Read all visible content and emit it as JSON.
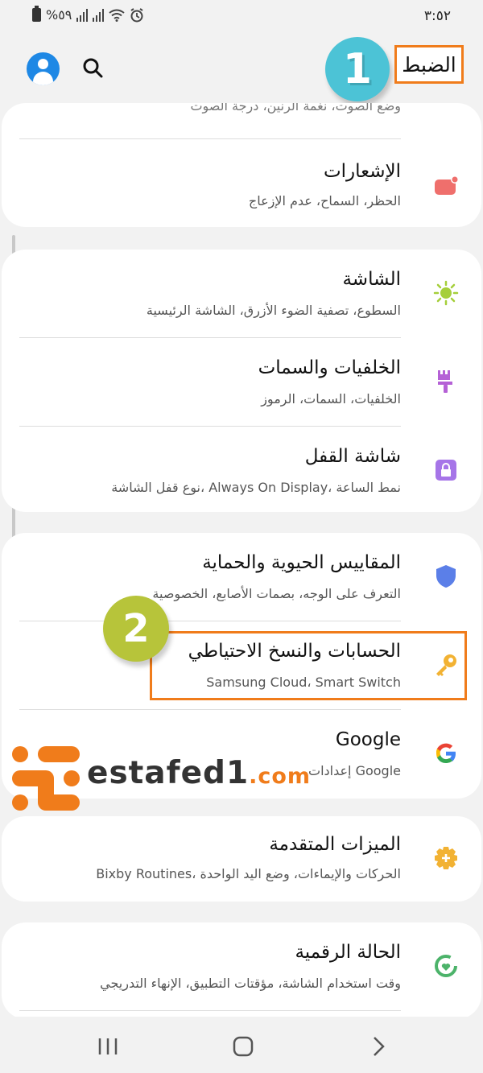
{
  "status_bar": {
    "time": "٣:٥٢",
    "battery": "%٥٩"
  },
  "header": {
    "title": "الضبط",
    "step1": "1"
  },
  "top_partial": {
    "subtitle": "وضع الصوت، نغمة الرنين، درجة الصوت"
  },
  "cards": [
    {
      "items": [
        {
          "title": "الإشعارات",
          "subtitle": "الحظر، السماح، عدم الإزعاج",
          "icon": "notification-icon"
        }
      ]
    },
    {
      "items": [
        {
          "title": "الشاشة",
          "subtitle": "السطوع، تصفية الضوء الأزرق، الشاشة الرئيسية",
          "icon": "sun-icon"
        },
        {
          "title": "الخلفيات والسمات",
          "subtitle": "الخلفيات، السمات، الرموز",
          "icon": "brush-icon"
        },
        {
          "title": "شاشة القفل",
          "subtitle": "نوع قفل الشاشة، Always On Display، نمط الساعة",
          "icon": "lock-icon"
        }
      ]
    },
    {
      "items": [
        {
          "title": "المقاييس الحيوية والحماية",
          "subtitle": "التعرف على الوجه، بصمات الأصابع، الخصوصية",
          "icon": "shield-icon"
        },
        {
          "title": "الحسابات والنسخ الاحتياطي",
          "subtitle": "Samsung Cloud، Smart Switch",
          "icon": "key-icon"
        },
        {
          "title": "Google",
          "subtitle": "إعدادات Google",
          "icon": "google-icon"
        }
      ]
    },
    {
      "items": [
        {
          "title": "الميزات المتقدمة",
          "subtitle": "Bixby Routines، الحركات والإيماءات، وضع اليد الواحدة",
          "icon": "gear-plus-icon"
        }
      ]
    },
    {
      "items": [
        {
          "title": "الحالة الرقمية",
          "subtitle": "وقت استخدام الشاشة، مؤقتات التطبيق، الإنهاء التدريجي",
          "icon": "wellbeing-icon"
        }
      ]
    }
  ],
  "step2": "2",
  "watermark": {
    "name": "estafed1",
    "domain": ".com"
  },
  "colors": {
    "accent_orange": "#f07c1b",
    "badge1": "#4cc3d6",
    "badge2": "#b7c43a"
  }
}
